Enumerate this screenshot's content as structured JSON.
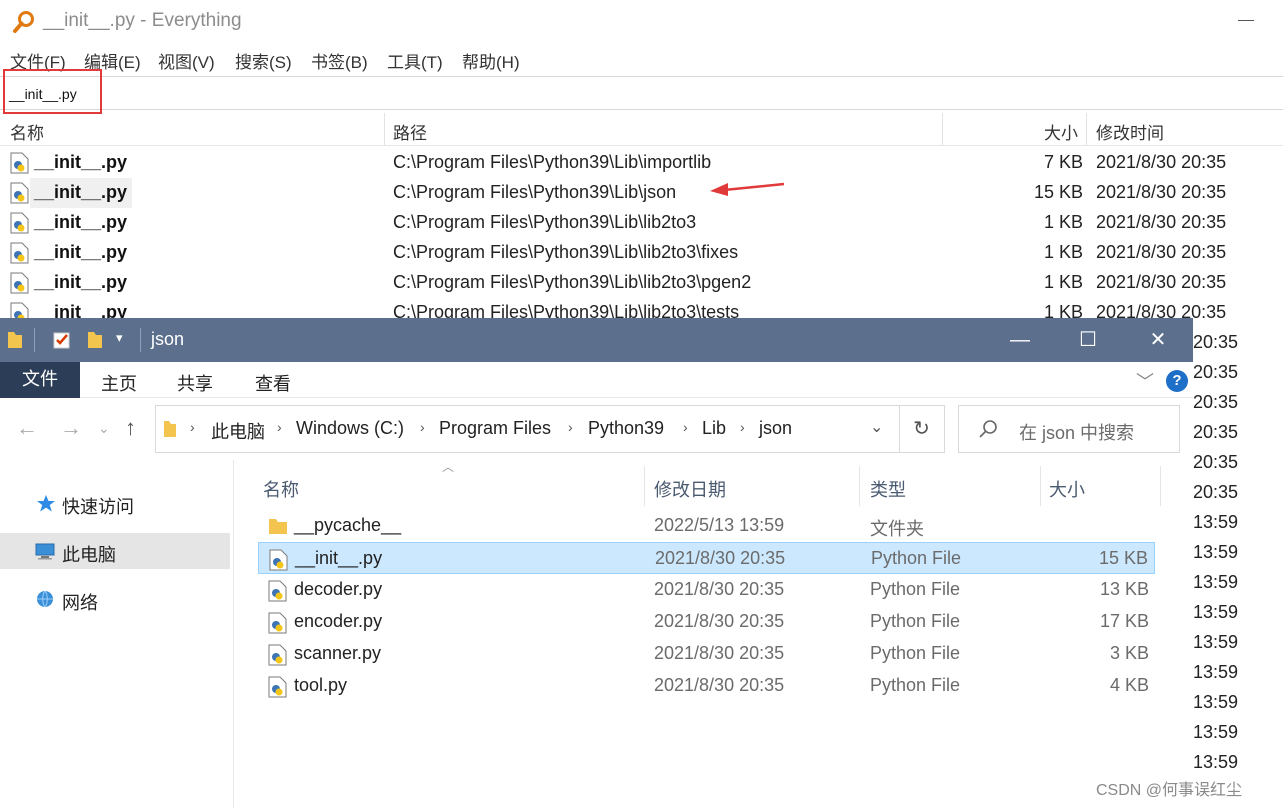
{
  "everything": {
    "title": "__init__.py - Everything",
    "menu": [
      "文件(F)",
      "编辑(E)",
      "视图(V)",
      "搜索(S)",
      "书签(B)",
      "工具(T)",
      "帮助(H)"
    ],
    "search_value": "__init__.py",
    "columns": {
      "name": "名称",
      "path": "路径",
      "size": "大小",
      "modified": "修改时间"
    },
    "rows": [
      {
        "name": "__init__.py",
        "path": "C:\\Program Files\\Python39\\Lib\\importlib",
        "size": "7 KB",
        "modified": "2021/8/30 20:35"
      },
      {
        "name": "__init__.py",
        "path": "C:\\Program Files\\Python39\\Lib\\json",
        "size": "15 KB",
        "modified": "2021/8/30 20:35"
      },
      {
        "name": "__init__.py",
        "path": "C:\\Program Files\\Python39\\Lib\\lib2to3",
        "size": "1 KB",
        "modified": "2021/8/30 20:35"
      },
      {
        "name": "__init__.py",
        "path": "C:\\Program Files\\Python39\\Lib\\lib2to3\\fixes",
        "size": "1 KB",
        "modified": "2021/8/30 20:35"
      },
      {
        "name": "__init__.py",
        "path": "C:\\Program Files\\Python39\\Lib\\lib2to3\\pgen2",
        "size": "1 KB",
        "modified": "2021/8/30 20:35"
      },
      {
        "name": "__init__.py",
        "path": "C:\\Program Files\\Python39\\Lib\\lib2to3\\tests",
        "size": "1 KB",
        "modified": "2021/8/30 20:35"
      }
    ],
    "hidden_times": [
      "20:35",
      "20:35",
      "20:35",
      "20:35",
      "20:35",
      "20:35",
      "13:59",
      "13:59",
      "13:59",
      "13:59",
      "13:59",
      "13:59",
      "13:59",
      "13:59",
      "13:59"
    ]
  },
  "explorer": {
    "title": "json",
    "ribbon_tabs": {
      "file": "文件",
      "home": "主页",
      "share": "共享",
      "view": "查看"
    },
    "breadcrumb": [
      "此电脑",
      "Windows (C:)",
      "Program Files",
      "Python39",
      "Lib",
      "json"
    ],
    "search_placeholder": "在 json 中搜索",
    "sidebar": [
      "快速访问",
      "此电脑",
      "网络"
    ],
    "columns": {
      "name": "名称",
      "modified": "修改日期",
      "type": "类型",
      "size": "大小"
    },
    "files": [
      {
        "name": "__pycache__",
        "modified": "2022/5/13 13:59",
        "type": "文件夹",
        "size": ""
      },
      {
        "name": "__init__.py",
        "modified": "2021/8/30 20:35",
        "type": "Python File",
        "size": "15 KB"
      },
      {
        "name": "decoder.py",
        "modified": "2021/8/30 20:35",
        "type": "Python File",
        "size": "13 KB"
      },
      {
        "name": "encoder.py",
        "modified": "2021/8/30 20:35",
        "type": "Python File",
        "size": "17 KB"
      },
      {
        "name": "scanner.py",
        "modified": "2021/8/30 20:35",
        "type": "Python File",
        "size": "3 KB"
      },
      {
        "name": "tool.py",
        "modified": "2021/8/30 20:35",
        "type": "Python File",
        "size": "4 KB"
      }
    ]
  },
  "watermark": "CSDN @何事误红尘",
  "colors": {
    "highlight_red": "#e03a3a",
    "explorer_title": "#5c6f8c",
    "selection": "#cce8ff"
  }
}
